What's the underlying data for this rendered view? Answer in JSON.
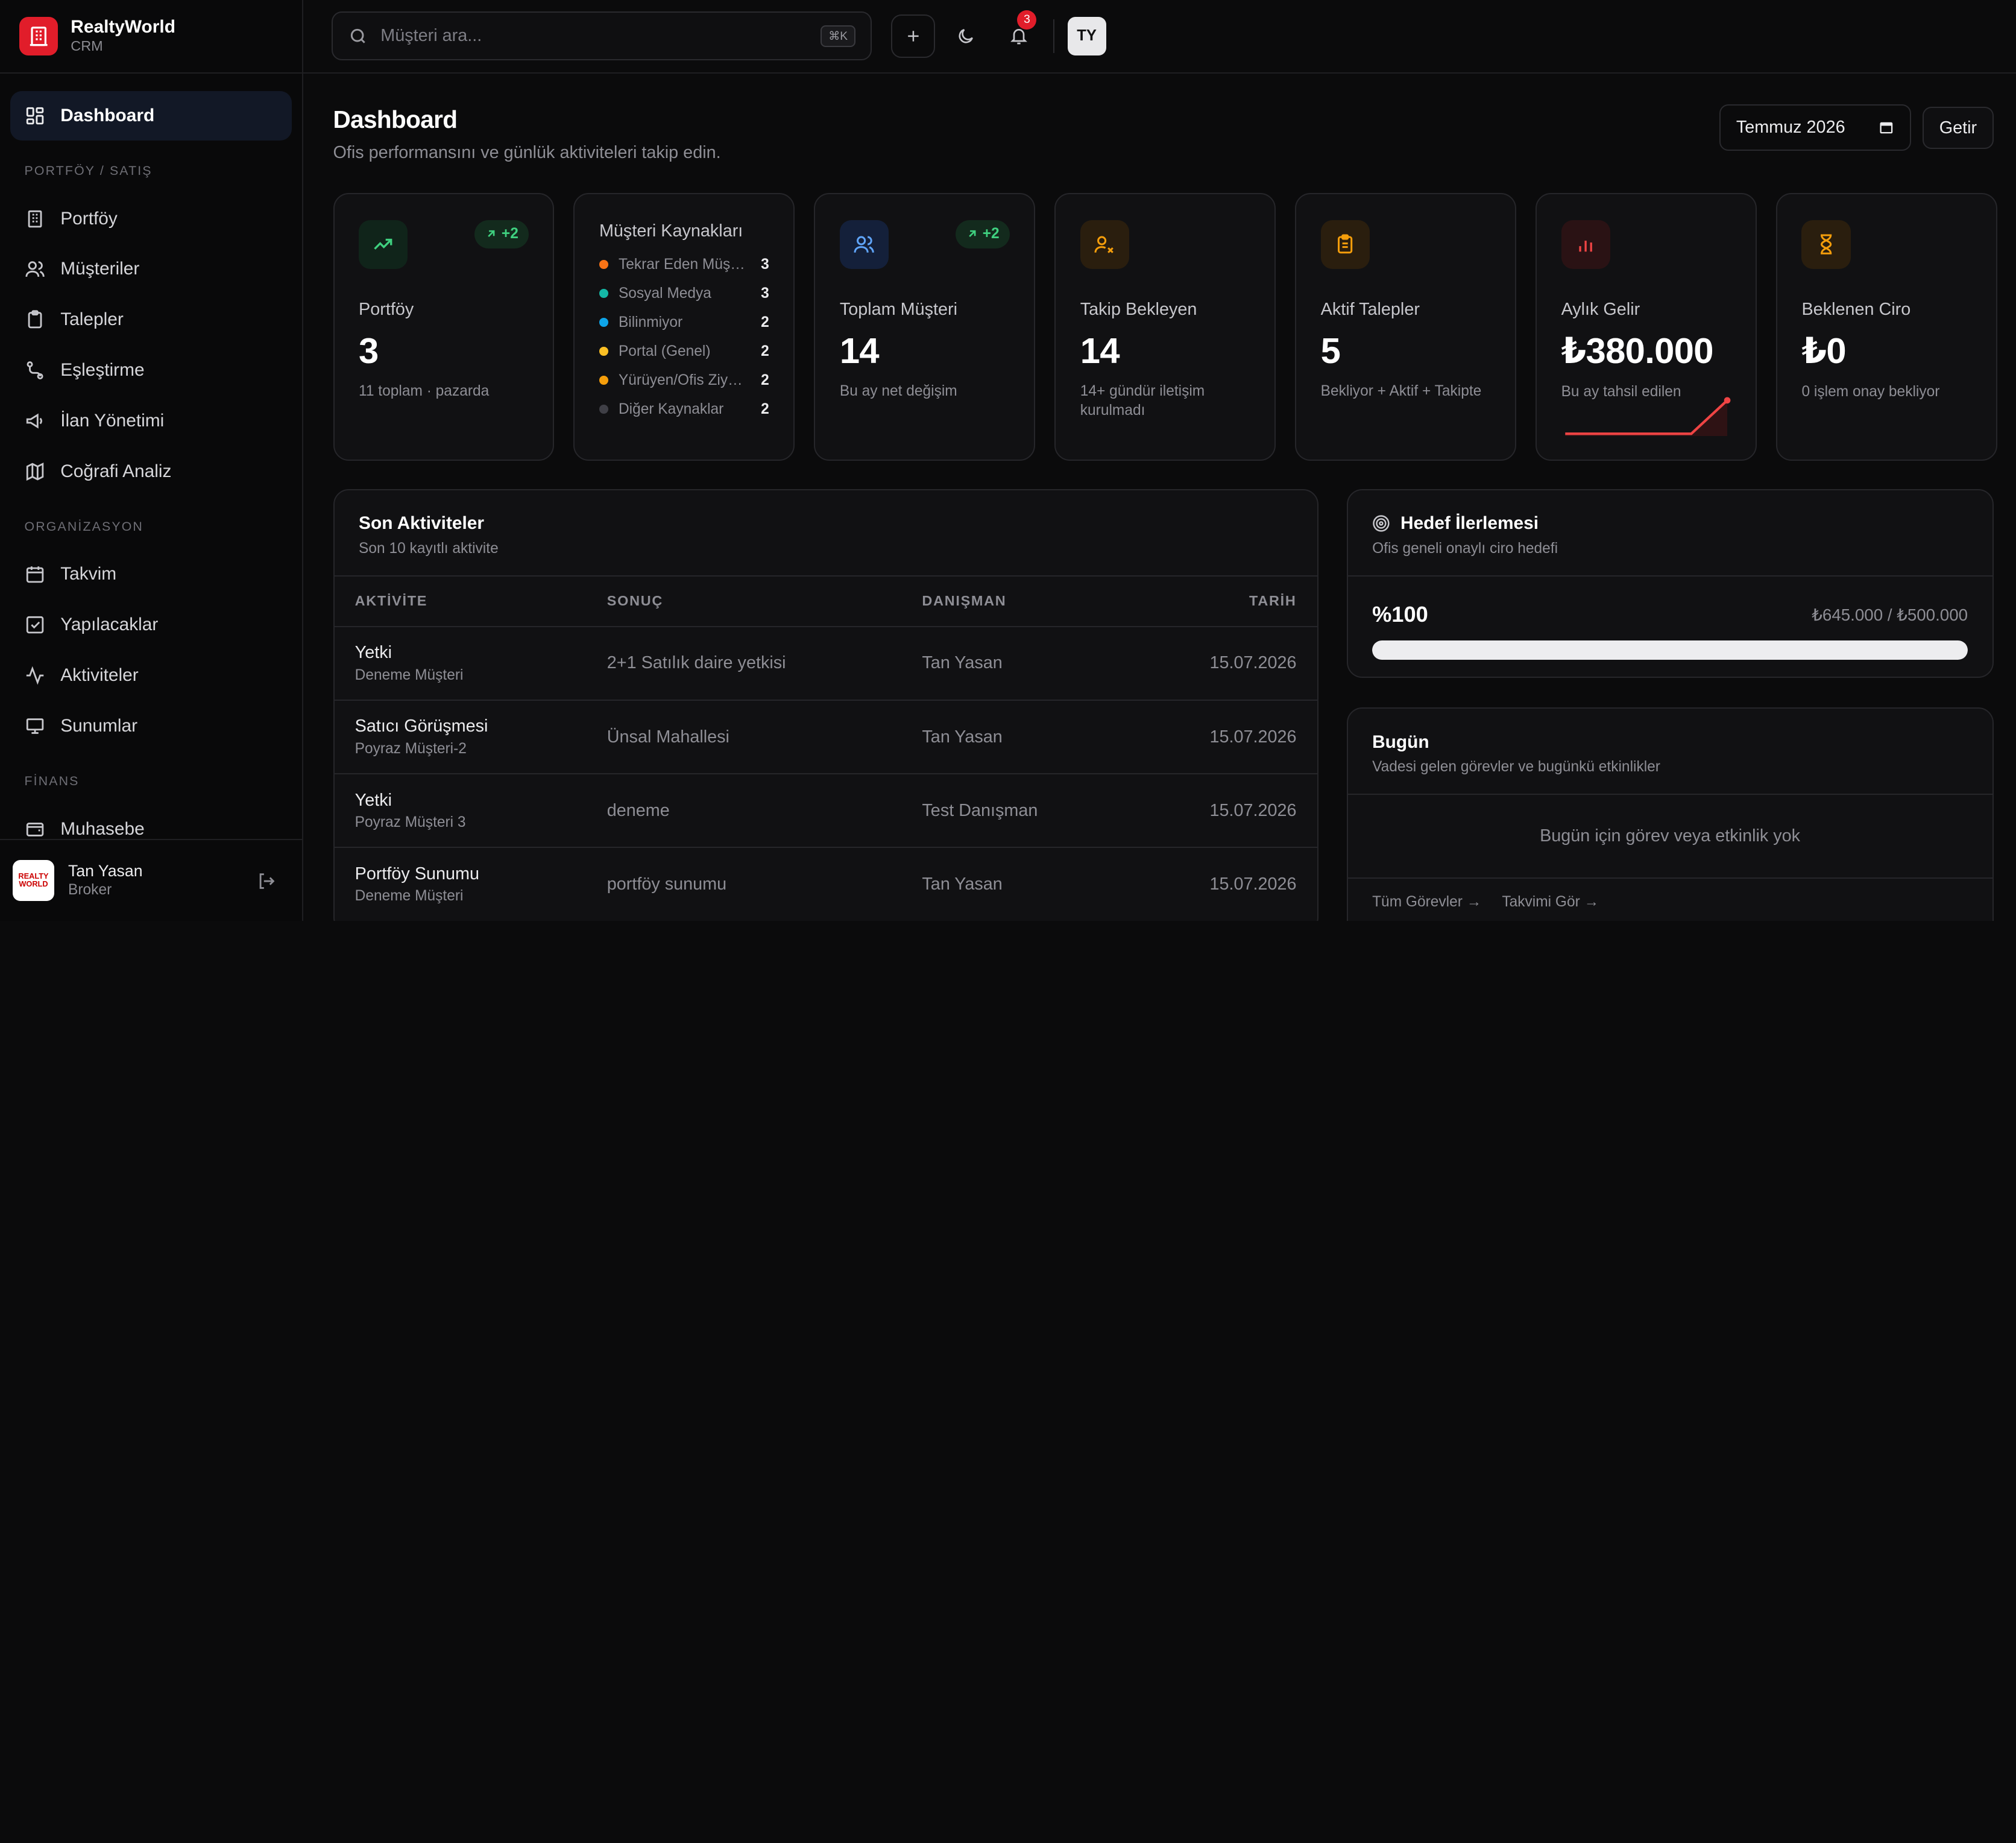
{
  "brand": {
    "name": "RealtyWorld",
    "sub": "CRM"
  },
  "nav": {
    "dashboard": "Dashboard",
    "section_portfolio": "PORTFÖY / SATIŞ",
    "portfolio": "Portföy",
    "customers": "Müşteriler",
    "requests": "Talepler",
    "matching": "Eşleştirme",
    "listings": "İlan Yönetimi",
    "geo": "Coğrafi Analiz",
    "section_org": "ORGANİZASYON",
    "calendar": "Takvim",
    "todos": "Yapılacaklar",
    "activities": "Aktiviteler",
    "presentations": "Sunumlar",
    "section_finance": "FİNANS",
    "accounting": "Muhasebe"
  },
  "user": {
    "name": "Tan Yasan",
    "role": "Broker",
    "logo_text": "REALTY WORLD",
    "initials": "TY"
  },
  "search": {
    "placeholder": "Müşteri ara...",
    "shortcut": "⌘K"
  },
  "notifications": {
    "count": "3"
  },
  "page": {
    "title": "Dashboard",
    "subtitle": "Ofis performansını ve günlük aktiviteleri takip edin."
  },
  "period": {
    "value": "Temmuz 2026",
    "button": "Getir"
  },
  "cards": {
    "portfolio": {
      "label": "Portföy",
      "value": "3",
      "note": "11 toplam · pazarda",
      "delta": "+2"
    },
    "sources": {
      "title": "Müşteri Kaynakları",
      "items": [
        {
          "name": "Tekrar Eden Müşteri",
          "value": "3",
          "color": "#f97316"
        },
        {
          "name": "Sosyal Medya",
          "value": "3",
          "color": "#14b8a6"
        },
        {
          "name": "Bilinmiyor",
          "value": "2",
          "color": "#0ea5e9"
        },
        {
          "name": "Portal (Genel)",
          "value": "2",
          "color": "#fbbf24"
        },
        {
          "name": "Yürüyen/Ofis Ziyareti",
          "value": "2",
          "color": "#f59e0b"
        },
        {
          "name": "Diğer Kaynaklar",
          "value": "2",
          "color": "#3f3f46"
        }
      ]
    },
    "customers": {
      "label": "Toplam Müşteri",
      "value": "14",
      "note": "Bu ay net değişim",
      "delta": "+2"
    },
    "followup": {
      "label": "Takip Bekleyen",
      "value": "14",
      "note": "14+ gündür iletişim kurulmadı"
    },
    "active": {
      "label": "Aktif Talepler",
      "value": "5",
      "note": "Bekliyor + Aktif + Takipte"
    },
    "income": {
      "label": "Aylık Gelir",
      "value": "₺380.000",
      "note": "Bu ay tahsil edilen"
    },
    "expected": {
      "label": "Beklenen Ciro",
      "value": "₺0",
      "note": "0 işlem onay bekliyor"
    }
  },
  "activities": {
    "title": "Son Aktiviteler",
    "subtitle": "Son 10 kayıtlı aktivite",
    "columns": {
      "activity": "AKTİVİTE",
      "result": "SONUÇ",
      "agent": "DANIŞMAN",
      "date": "TARİH"
    },
    "rows": [
      {
        "activity": "Yetki",
        "customer": "Deneme Müşteri",
        "result": "2+1 Satılık daire yetkisi",
        "agent": "Tan Yasan",
        "date": "15.07.2026"
      },
      {
        "activity": "Satıcı Görüşmesi",
        "customer": "Poyraz Müşteri-2",
        "result": "Ünsal Mahallesi",
        "agent": "Tan Yasan",
        "date": "15.07.2026"
      },
      {
        "activity": "Yetki",
        "customer": "Poyraz Müşteri 3",
        "result": "deneme",
        "agent": "Test Danışman",
        "date": "15.07.2026"
      },
      {
        "activity": "Portföy Sunumu",
        "customer": "Deneme Müşteri",
        "result": "portföy sunumu",
        "agent": "Tan Yasan",
        "date": "15.07.2026"
      }
    ]
  },
  "goal": {
    "title": "Hedef İlerlemesi",
    "subtitle": "Ofis geneli onaylı ciro hedefi",
    "percent_label": "%100",
    "amount": "₺645.000 / ₺500.000",
    "progress": 1.0
  },
  "today": {
    "title": "Bugün",
    "subtitle": "Vadesi gelen görevler ve bugünkü etkinlikler",
    "empty": "Bugün için görev veya etkinlik yok",
    "link_tasks": "Tüm Görevler →",
    "link_calendar": "Takvimi Gör →"
  }
}
